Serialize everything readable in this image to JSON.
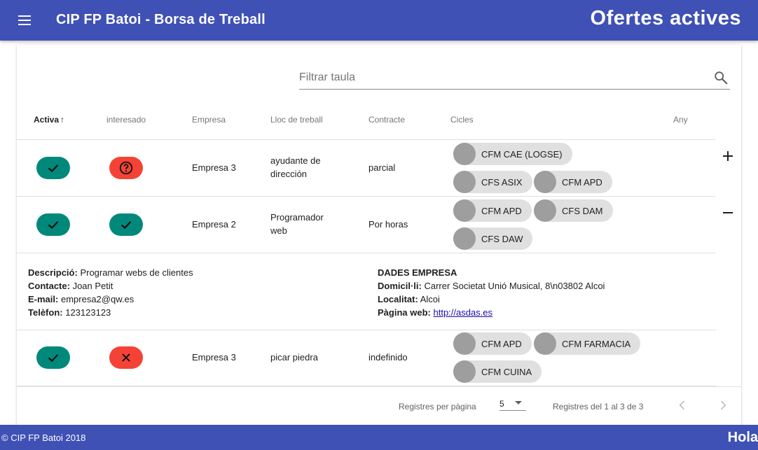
{
  "header": {
    "app_title": "CIP FP Batoi - Borsa de Treball",
    "page_title": "Ofertes actives"
  },
  "search": {
    "placeholder": "Filtrar taula"
  },
  "table": {
    "columns": [
      "Activa",
      "interesado",
      "Empresa",
      "Lloc de treball",
      "Contracte",
      "Cicles",
      "Any"
    ],
    "rows": [
      {
        "activa": "active",
        "interesado": "question",
        "empresa": "Empresa 3",
        "lloc": "ayudante de dirección",
        "contracte": "parcial",
        "cicles": [
          "CFM CAE (LOGSE)",
          "CFS ASIX",
          "CFM APD"
        ],
        "any": "",
        "expand_icon": "plus-icon"
      },
      {
        "activa": "active",
        "interesado": "yes",
        "empresa": "Empresa 2",
        "lloc": "Programador web",
        "contracte": "Por horas",
        "cicles": [
          "CFM APD",
          "CFS DAM",
          "CFS DAW"
        ],
        "any": "",
        "expand_icon": "minus-icon"
      },
      {
        "activa": "active",
        "interesado": "no",
        "empresa": "Empresa 3",
        "lloc": "picar piedra",
        "contracte": "indefinido",
        "cicles": [
          "CFM APD",
          "CFM FARMACIA",
          "CFM CUINA"
        ],
        "any": ""
      }
    ],
    "detail": {
      "descripcio_label": "Descripció:",
      "descripcio": "Programar webs de clientes",
      "contacte_label": "Contacte:",
      "contacte": "Joan Petit",
      "email_label": "E-mail:",
      "email": "empresa2@qw.es",
      "telefon_label": "Telèfon:",
      "telefon": "123123123",
      "dades_title": "DADES EMPRESA",
      "domicili_label": "Domicil·li:",
      "domicili": "Carrer Societat Unió Musical, 8\\n03802 Alcoi",
      "localitat_label": "Localitat:",
      "localitat": "Alcoi",
      "web_label": "Pàgina web:",
      "web": "http://asdas.es"
    }
  },
  "pagination": {
    "rows_per_page_label": "Registres per pàgina",
    "rows_per_page": "5",
    "range_text": "Registres del 1 al 3 de 3"
  },
  "footer": {
    "copyright": "© CIP FP Batoi 2018",
    "greeting": "Hola"
  },
  "colors": {
    "primary": "#3f51b5",
    "success": "#00897b",
    "error": "#f44336",
    "chip": "#e0e0e0"
  }
}
